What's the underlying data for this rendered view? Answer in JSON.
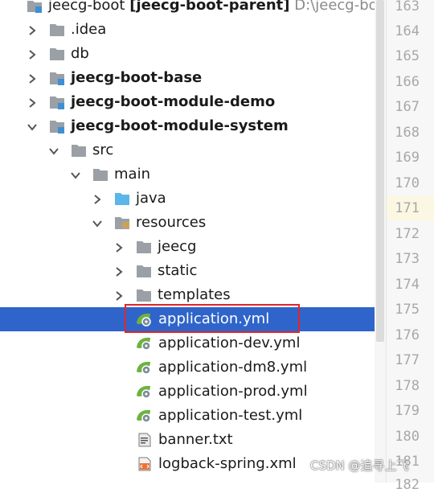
{
  "tree": {
    "root": {
      "name": "jeecg-boot",
      "module": "[jeecg-boot-parent]",
      "path": "D:\\jeecg-boot-r"
    },
    "items": [
      {
        "label": ".idea",
        "icon": "folder-icon"
      },
      {
        "label": "db",
        "icon": "folder-icon"
      },
      {
        "label": "jeecg-boot-base",
        "icon": "module-icon"
      },
      {
        "label": "jeecg-boot-module-demo",
        "icon": "module-icon"
      },
      {
        "label": "jeecg-boot-module-system",
        "icon": "module-icon"
      },
      {
        "label": "src",
        "icon": "folder-icon"
      },
      {
        "label": "main",
        "icon": "folder-icon"
      },
      {
        "label": "java",
        "icon": "source-folder-icon"
      },
      {
        "label": "resources",
        "icon": "resources-folder-icon"
      },
      {
        "label": "jeecg",
        "icon": "folder-icon"
      },
      {
        "label": "static",
        "icon": "folder-icon"
      },
      {
        "label": "templates",
        "icon": "folder-icon"
      },
      {
        "label": "application.yml",
        "icon": "spring-yml-icon"
      },
      {
        "label": "application-dev.yml",
        "icon": "spring-yml-icon"
      },
      {
        "label": "application-dm8.yml",
        "icon": "spring-yml-icon"
      },
      {
        "label": "application-prod.yml",
        "icon": "spring-yml-icon"
      },
      {
        "label": "application-test.yml",
        "icon": "spring-yml-icon"
      },
      {
        "label": "banner.txt",
        "icon": "text-file-icon"
      },
      {
        "label": "logback-spring.xml",
        "icon": "xml-file-icon"
      }
    ]
  },
  "gutter": {
    "line_numbers": [
      "163",
      "164",
      "165",
      "166",
      "167",
      "168",
      "169",
      "170",
      "171",
      "172",
      "173",
      "174",
      "175",
      "176",
      "177",
      "178",
      "179",
      "180",
      "181",
      "182"
    ],
    "current_line": "171"
  },
  "watermark": "CSDN @追寻上飞",
  "colors": {
    "selection": "#2f65ca",
    "highlight_box": "#e0262a",
    "folder": "#9aa0a6",
    "source_folder": "#5cb6e8",
    "spring": "#6db33f"
  }
}
